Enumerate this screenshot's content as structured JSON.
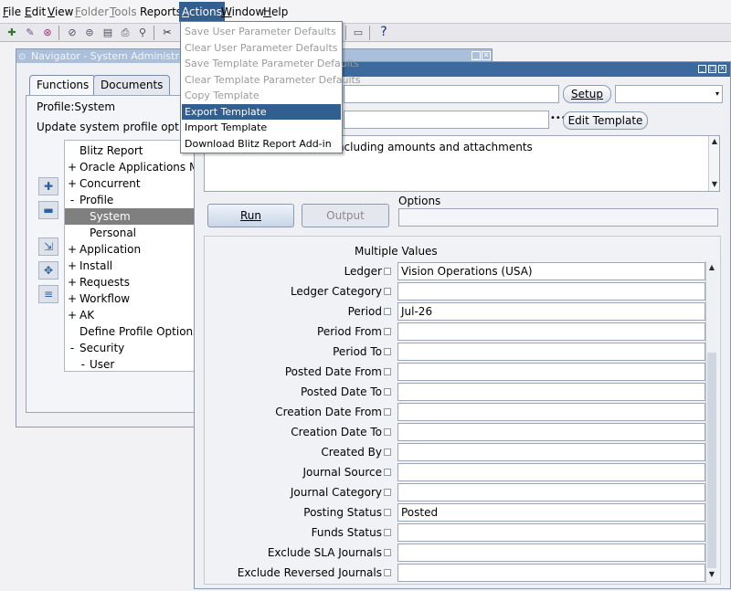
{
  "menubar": {
    "items": [
      {
        "label": "File",
        "state": "normal"
      },
      {
        "label": "Edit",
        "state": "normal"
      },
      {
        "label": "View",
        "state": "normal"
      },
      {
        "label": "Folder",
        "state": "disabled"
      },
      {
        "label": "Tools",
        "state": "disabled"
      },
      {
        "label": "Reports",
        "state": "normal"
      },
      {
        "label": "Actions",
        "state": "active"
      },
      {
        "label": "Window",
        "state": "normal"
      },
      {
        "label": "Help",
        "state": "normal"
      }
    ]
  },
  "toolbar": {
    "icons": [
      "new-icon",
      "edit-icon",
      "zoom-icon",
      "folder-icon",
      "open-icon",
      "save-icon",
      "print-icon",
      "attach-icon",
      "cut-icon",
      "lock-icon",
      "help-icon"
    ],
    "help_glyph": "?"
  },
  "actions_menu": {
    "items": [
      {
        "label": "Save User Parameter Defaults",
        "state": "disabled"
      },
      {
        "label": "Clear User Parameter Defaults",
        "state": "disabled"
      },
      {
        "label": "Save Template Parameter Defaults",
        "state": "disabled"
      },
      {
        "label": "Clear Template Parameter Defaults",
        "state": "disabled"
      },
      {
        "label": "Copy Template",
        "state": "disabled"
      },
      {
        "label": "Export Template",
        "state": "highlighted"
      },
      {
        "label": "Import Template",
        "state": "normal"
      },
      {
        "label": "Download Blitz Report Add-in",
        "state": "normal"
      }
    ]
  },
  "navigator": {
    "title": "Navigator - System Administrator",
    "tabs": [
      "Functions",
      "Documents"
    ],
    "profile_label": "Profile:System",
    "hint": "Update system profile options",
    "tree": [
      {
        "label": "Blitz Report",
        "prefix": "",
        "indent": 0
      },
      {
        "label": "Oracle Applications Ma",
        "prefix": "+",
        "indent": 0
      },
      {
        "label": "Concurrent",
        "prefix": "+",
        "indent": 0
      },
      {
        "label": "Profile",
        "prefix": "-",
        "indent": 0
      },
      {
        "label": "System",
        "prefix": "",
        "indent": 1,
        "selected": true
      },
      {
        "label": "Personal",
        "prefix": "",
        "indent": 1
      },
      {
        "label": "Application",
        "prefix": "+",
        "indent": 0
      },
      {
        "label": "Install",
        "prefix": "+",
        "indent": 0
      },
      {
        "label": "Requests",
        "prefix": "+",
        "indent": 0
      },
      {
        "label": "Workflow",
        "prefix": "+",
        "indent": 0
      },
      {
        "label": "AK",
        "prefix": "+",
        "indent": 0
      },
      {
        "label": "Define Profile Options",
        "prefix": "",
        "indent": 0
      },
      {
        "label": "Security",
        "prefix": "-",
        "indent": 0
      },
      {
        "label": "User",
        "prefix": "-",
        "indent": 1
      }
    ],
    "side_buttons": [
      "expand-icon",
      "collapse-icon",
      "expand-branch-icon",
      "expand-all-icon",
      "collapse-all-icon"
    ]
  },
  "report": {
    "setup_label": "Setup",
    "edit_template_label": "Edit Template",
    "description": "ort, including amounts and attachments",
    "run_label": "Run",
    "output_label": "Output",
    "options_label": "Options",
    "multiple_values_label": "Multiple Values",
    "params": [
      {
        "label": "Ledger",
        "value": "Vision Operations (USA)"
      },
      {
        "label": "Ledger Category",
        "value": ""
      },
      {
        "label": "Period",
        "value": "Jul-26"
      },
      {
        "label": "Period From",
        "value": ""
      },
      {
        "label": "Period To",
        "value": ""
      },
      {
        "label": "Posted Date From",
        "value": ""
      },
      {
        "label": "Posted Date To",
        "value": ""
      },
      {
        "label": "Creation Date From",
        "value": ""
      },
      {
        "label": "Creation Date To",
        "value": ""
      },
      {
        "label": "Created By",
        "value": ""
      },
      {
        "label": "Journal Source",
        "value": ""
      },
      {
        "label": "Journal Category",
        "value": ""
      },
      {
        "label": "Posting Status",
        "value": "Posted"
      },
      {
        "label": "Funds Status",
        "value": ""
      },
      {
        "label": "Exclude SLA Journals",
        "value": ""
      },
      {
        "label": "Exclude Reversed Journals",
        "value": ""
      }
    ]
  },
  "colors": {
    "menu_highlight": "#335e90",
    "tree_selected": "#7f7f7f",
    "title_active": "#3c6a9e"
  }
}
